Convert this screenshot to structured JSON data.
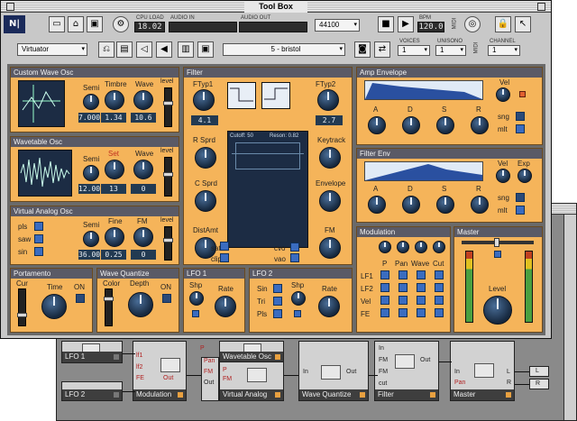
{
  "window_title": "Tool Box",
  "toolbar": {
    "cpu_label": "CPU LOAD",
    "cpu_value": "18.02",
    "audio_in_label": "AUDIO IN",
    "audio_out_label": "AUDIO OUT",
    "sample_rate": "44100",
    "bpm_label": "BPM",
    "bpm_value": "120.0",
    "midi_label": "MIDI",
    "instrument": "Virtuator",
    "preset": "5 - bristol",
    "voices_label": "VOICES",
    "voices_value": "1",
    "unisono_label": "UNISONO",
    "unisono_value": "1",
    "channel_label": "CHANNEL",
    "channel_value": "1",
    "midi_label2": "MIDI"
  },
  "custom_wave_osc": {
    "title": "Custom Wave Osc",
    "semi_label": "Semi",
    "semi_value": "7.000",
    "timbre_label": "Timbre",
    "timbre_value": "1.34",
    "wave_label": "Wave",
    "wave_value": "10.6",
    "level_label": "level"
  },
  "wavetable_osc": {
    "title": "Wavetable Osc",
    "semi_label": "Semi",
    "semi_value": "12.00",
    "set_label": "Set",
    "set_value": "13",
    "wave_label": "Wave",
    "wave_value": "0",
    "level_label": "level"
  },
  "virtual_analog_osc": {
    "title": "Virtual Analog Osc",
    "pls_label": "pls",
    "saw_label": "saw",
    "sin_label": "sin",
    "semi_label": "Semi",
    "semi_value": "36.00",
    "fine_label": "Fine",
    "fine_value": "0.25",
    "fm_label": "FM",
    "fm_value": "0",
    "level_label": "level"
  },
  "filter": {
    "title": "Filter",
    "ftyp1_label": "FTyp1",
    "ftyp1_value": "4.1",
    "ftyp2_label": "FTyp2",
    "ftyp2_value": "2.7",
    "rsprd_label": "R Sprd",
    "keytrack_label": "Keytrack",
    "csprd_label": "C Sprd",
    "envelope_label": "Envelope",
    "distamt_label": "DistAmt",
    "fm_label": "FM",
    "cutoff_readout": "Cutoff: 50",
    "reson_readout": "Reson: 0.82",
    "sat_label": "sat",
    "clip_label": "clip",
    "cvo_label": "cvo",
    "vao_label": "vao"
  },
  "amp_envelope": {
    "title": "Amp Envelope",
    "vel_label": "Vel",
    "a": "A",
    "d": "D",
    "s": "S",
    "r": "R",
    "sng_label": "sng",
    "mlt_label": "mlt"
  },
  "filter_env": {
    "title": "Filter Env",
    "vel_label": "Vel",
    "exp_label": "Exp",
    "a": "A",
    "d": "D",
    "s": "S",
    "r": "R",
    "sng_label": "sng",
    "mlt_label": "mlt"
  },
  "modulation": {
    "title": "Modulation",
    "cols": [
      "P",
      "Pan",
      "Wave",
      "Cut"
    ],
    "rows": [
      "LF1",
      "LF2",
      "Vel",
      "FE"
    ]
  },
  "master": {
    "title": "Master",
    "level_label": "Level"
  },
  "portamento": {
    "title": "Portamento",
    "cur_label": "Cur",
    "time_label": "Time",
    "on_label": "ON"
  },
  "wave_quantize": {
    "title": "Wave Quantize",
    "color_label": "Color",
    "depth_label": "Depth",
    "on_label": "ON"
  },
  "lfo1": {
    "title": "LFO 1",
    "shp_label": "Shp",
    "rate_label": "Rate"
  },
  "lfo2": {
    "title": "LFO 2",
    "sin_label": "Sin",
    "tri_label": "Tri",
    "pls_label": "Pls",
    "shp_label": "Shp",
    "rate_label": "Rate"
  },
  "structure": {
    "modules": {
      "lfo1": "LFO 1",
      "lfo2": "LFO 2",
      "modulation": "Modulation",
      "wavetable_osc": "Wavetable Osc",
      "virtual_analog": "Virtual Analog",
      "wave_quantize": "Wave Quantize",
      "filter": "Filter",
      "master": "Master"
    },
    "ports": {
      "lf1": "lf1",
      "lf2": "lf2",
      "fe": "FE",
      "out": "Out",
      "p": "P",
      "pan": "Pan",
      "fm": "FM",
      "in": "In",
      "cut": "cut",
      "l": "L",
      "r": "R"
    }
  },
  "icons": [
    "ni-logo",
    "new-icon",
    "open-icon",
    "save-icon",
    "cpu-icon",
    "stop-icon",
    "play-icon",
    "lock-icon",
    "pointer-icon",
    "midi-icon",
    "camera-icon",
    "speaker-icon",
    "disk-icon"
  ],
  "colors": {
    "panel": "#f5b45a",
    "knob": "#2a4a70",
    "display": "#1c2c44",
    "header": "#5a5a66"
  }
}
